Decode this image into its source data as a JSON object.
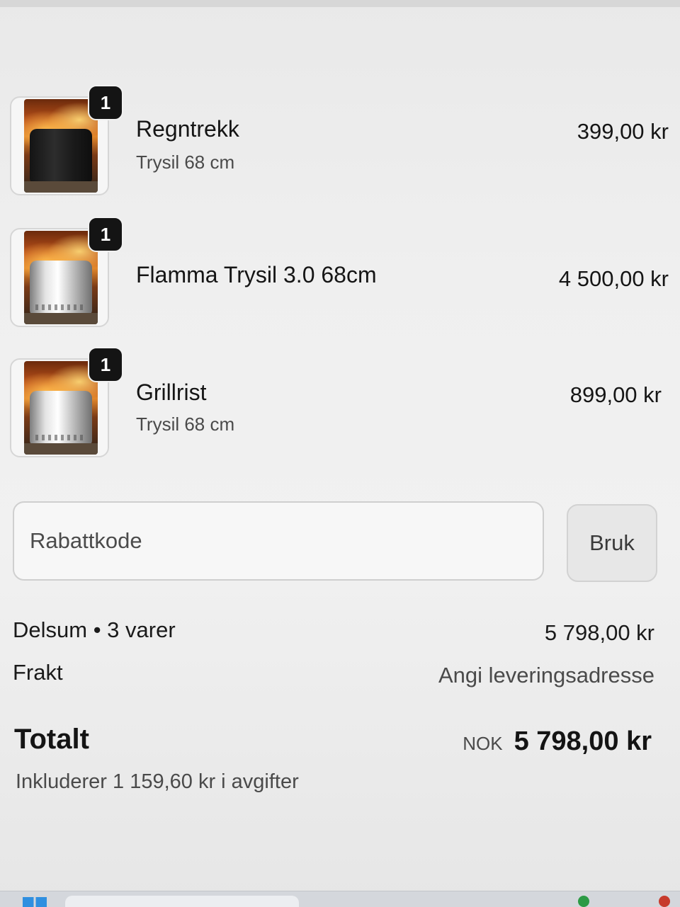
{
  "cart": {
    "items": [
      {
        "name": "Regntrekk",
        "variant": "Trysil 68 cm",
        "price": "399,00 kr",
        "quantity": "1",
        "thumbnail_icon": "fire-pit-rain-cover-icon"
      },
      {
        "name": "Flamma Trysil 3.0 68cm",
        "variant": "",
        "price": "4 500,00 kr",
        "quantity": "1",
        "thumbnail_icon": "fire-pit-icon"
      },
      {
        "name": "Grillrist",
        "variant": "Trysil 68 cm",
        "price": "899,00 kr",
        "quantity": "1",
        "thumbnail_icon": "fire-pit-grill-grate-icon"
      }
    ]
  },
  "discount": {
    "placeholder": "Rabattkode",
    "apply_label": "Bruk"
  },
  "summary": {
    "subtotal_label": "Delsum • 3 varer",
    "subtotal_value": "5 798,00 kr",
    "shipping_label": "Frakt",
    "shipping_value": "Angi leveringsadresse",
    "total_label": "Totalt",
    "currency_code": "NOK",
    "total_value": "5 798,00 kr",
    "tax_note": "Inkluderer 1 159,60 kr i avgifter"
  },
  "colors": {
    "background": "#efefef",
    "badge": "#141414",
    "text_primary": "#151515",
    "text_secondary": "#4a4a4a"
  }
}
